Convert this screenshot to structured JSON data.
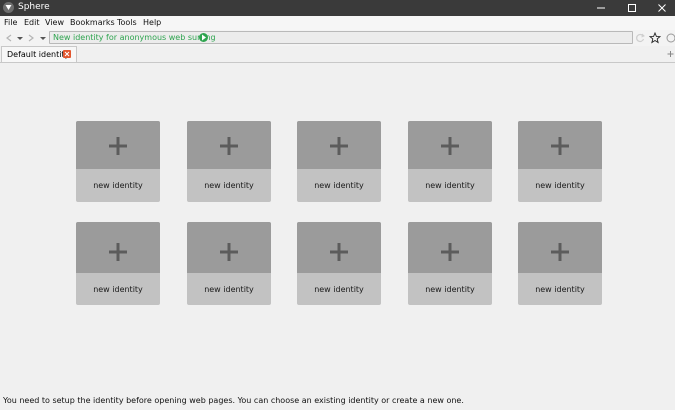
{
  "window": {
    "title": "Sphere"
  },
  "menu": [
    "File",
    "Edit",
    "View",
    "Bookmarks",
    "Tools",
    "Help"
  ],
  "address_bar": {
    "text": "New identity for anonymous web surfing"
  },
  "tabs": [
    {
      "label": "Default identity"
    }
  ],
  "cards": [
    "new identity",
    "new identity",
    "new identity",
    "new identity",
    "new identity",
    "new identity",
    "new identity",
    "new identity",
    "new identity",
    "new identity"
  ],
  "status": {
    "message": "You need to setup the identity before opening web pages. You can choose an existing identity or create a new one."
  },
  "colors": {
    "titlebar": "#3a3a3a",
    "url_text": "#2ea44f",
    "tab_close": "#e2572f",
    "card_top": "#9b9b9b",
    "card_bottom": "#c2c2c2"
  }
}
